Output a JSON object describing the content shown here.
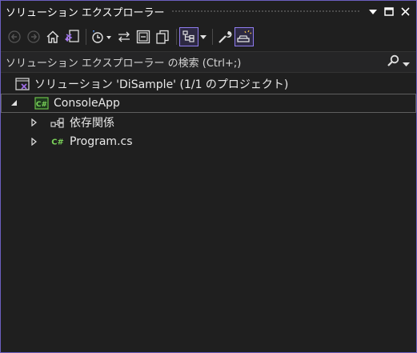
{
  "window": {
    "title": "ソリューション エクスプローラー"
  },
  "title_buttons": [
    {
      "name": "window-position-dropdown-icon"
    },
    {
      "name": "maximize-icon"
    },
    {
      "name": "close-icon"
    }
  ],
  "toolbar": {
    "accent_color": "#8f7cf0",
    "tools": [
      "back-icon",
      "forward-icon",
      "home-icon",
      "switch-views-icon",
      "pending-changes-filter-icon",
      "sync-with-active-document-icon",
      "collapse-all-icon",
      "show-all-files-icon",
      "preview-selected-items-icon",
      "properties-icon",
      "solution-explorer-toggle-icon"
    ]
  },
  "search": {
    "placeholder": "ソリューション エクスプローラー の検索 (Ctrl+;)"
  },
  "tree": {
    "solution": {
      "label": "ソリューション 'DiSample' (1/1 のプロジェクト)"
    },
    "project": {
      "label": "ConsoleApp",
      "expanded": true
    },
    "children": [
      {
        "label": "依存関係",
        "icon": "dependencies-icon"
      },
      {
        "label": "Program.cs",
        "icon": "csharp-file-icon"
      }
    ]
  }
}
